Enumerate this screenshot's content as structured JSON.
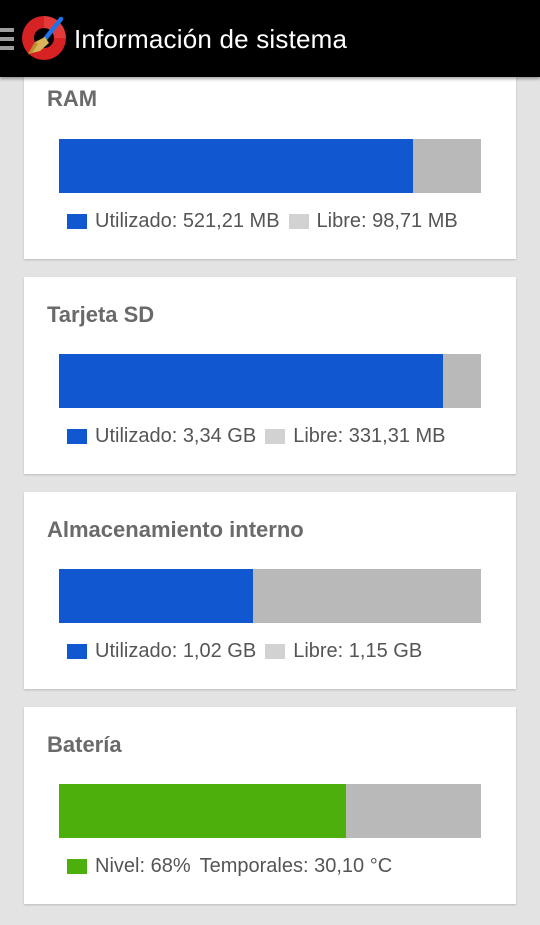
{
  "appbar": {
    "title": "Información de sistema",
    "menu_icon": "hamburger-menu-icon",
    "logo_icon": "ccleaner-logo-icon"
  },
  "colors": {
    "used": "#1157cf",
    "free": "#d2d2d2",
    "free_bar": "#b9b9b9",
    "battery": "#4daf0c"
  },
  "cards": [
    {
      "title": "RAM",
      "used_fraction": 0.839,
      "used_label": "Utilizado: 521,21 MB",
      "free_label": "Libre: 98,71 MB"
    },
    {
      "title": "Tarjeta SD",
      "used_fraction": 0.91,
      "used_label": "Utilizado: 3,34 GB",
      "free_label": "Libre: 331,31 MB"
    },
    {
      "title": "Almacenamiento interno",
      "used_fraction": 0.46,
      "used_label": "Utilizado: 1,02 GB",
      "free_label": "Libre: 1,15 GB"
    },
    {
      "title": "Batería",
      "level_fraction": 0.68,
      "level_label": "Nivel: 68%",
      "temp_label": "Temporales: 30,10 °C"
    }
  ]
}
